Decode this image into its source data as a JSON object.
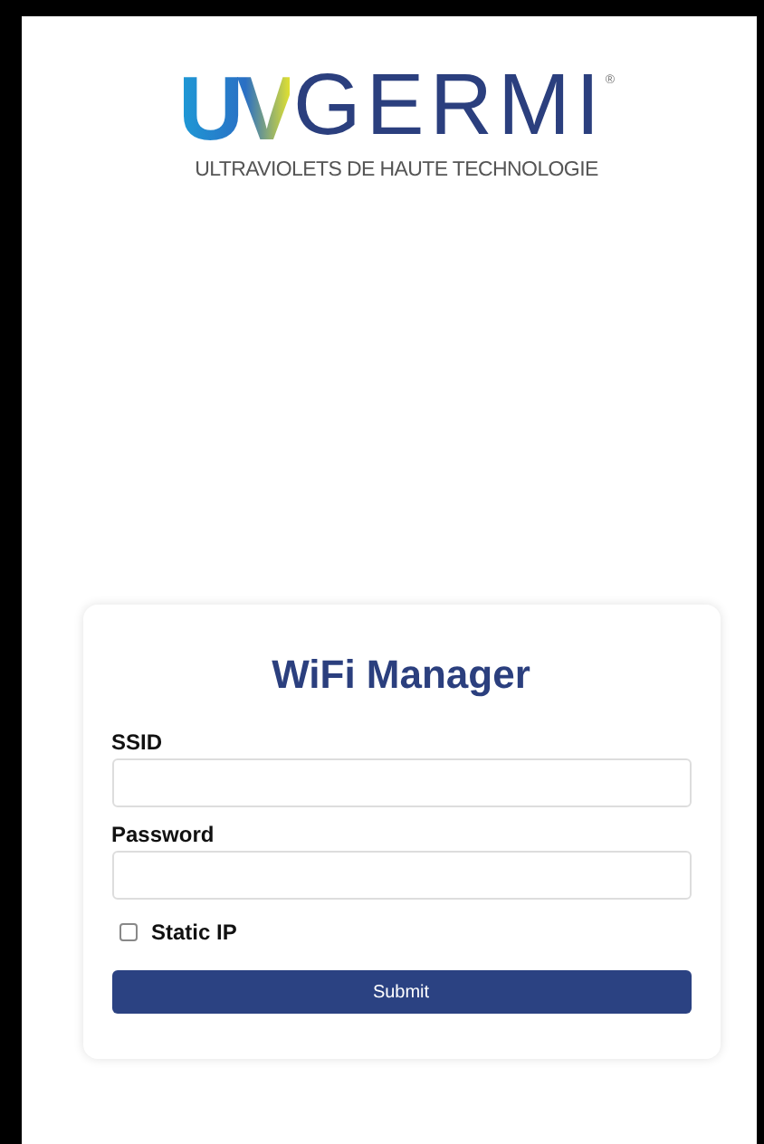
{
  "logo": {
    "mark": "UV",
    "name": "GERMI",
    "registered": "®",
    "tagline": "ULTRAVIOLETS DE HAUTE TECHNOLOGIE"
  },
  "form": {
    "title": "WiFi Manager",
    "fields": [
      {
        "label": "SSID"
      },
      {
        "label": "Password"
      }
    ],
    "static_ip": {
      "label": "Static IP",
      "checked": false
    },
    "submit": "Submit"
  }
}
